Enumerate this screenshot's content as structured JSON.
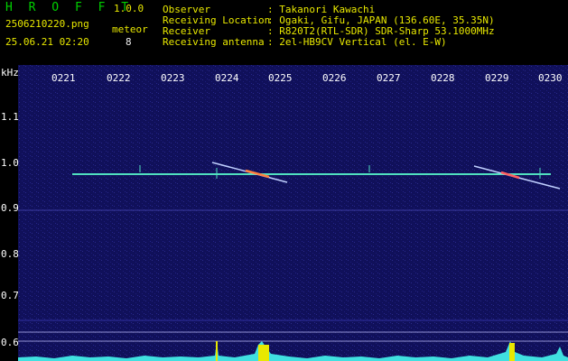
{
  "header": {
    "app_name": "H R O F F T",
    "version": "1.0.0",
    "filename": "2506210220.png",
    "datetime": "25.06.21 02:20",
    "meteor_label": "meteor",
    "meteor_count": "8",
    "observer_key": "Observer",
    "observer_val": ": Takanori Kawachi",
    "location_key": "Receiving Location",
    "location_val": ": Ogaki, Gifu, JAPAN (136.60E, 35.35N)",
    "receiver_key": "Receiver",
    "receiver_val": ": R820T2(RTL-SDR) SDR-Sharp 53.1000MHz",
    "antenna_key": "Receiving antenna",
    "antenna_val": ": 2el-HB9CV Vertical (el. E-W)"
  },
  "axis": {
    "unit": "kHz",
    "y_ticks": [
      "1.1",
      "1.0",
      "0.9",
      "0.8",
      "0.7",
      "0.6"
    ],
    "x_ticks": [
      "0221",
      "0222",
      "0223",
      "0224",
      "0225",
      "0226",
      "0227",
      "0228",
      "0229",
      "0230"
    ]
  },
  "colors": {
    "background": "#10105a",
    "carrier": "#50e0c0",
    "meteor": "#c0d0ff",
    "header_green": "#00d000",
    "header_yellow": "#e8e800"
  }
}
